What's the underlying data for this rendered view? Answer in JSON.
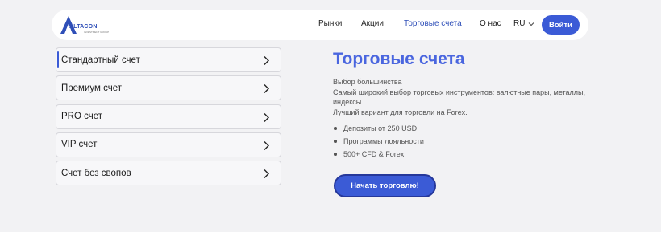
{
  "brand": {
    "name": "ALTACON",
    "tagline": "INVESTMENT GROUP"
  },
  "nav": {
    "items": [
      {
        "label": "Рынки"
      },
      {
        "label": "Акции"
      },
      {
        "label": "Торговые счета"
      },
      {
        "label": "О нас"
      }
    ],
    "lang": "RU",
    "login": "Войти"
  },
  "accounts": {
    "items": [
      {
        "label": "Стандартный счет"
      },
      {
        "label": "Премиум счет"
      },
      {
        "label": "PRO счет"
      },
      {
        "label": "VIP счет"
      },
      {
        "label": "Счет без свопов"
      }
    ]
  },
  "detail": {
    "title": "Торговые счета",
    "lines": [
      "Выбор большинства",
      "Самый широкий выбор торговых инструментов: валютные пары, металлы, индексы.",
      "Лучший вариант для торговли на Forex."
    ],
    "bullets": [
      "Депозиты от 250 USD",
      "Программы лояльности",
      "500+ CFD & Forex"
    ],
    "cta": "Начать торговлю!"
  },
  "colors": {
    "accent": "#3b5bd6",
    "title": "#4a66df",
    "background": "#f2f2f4"
  }
}
